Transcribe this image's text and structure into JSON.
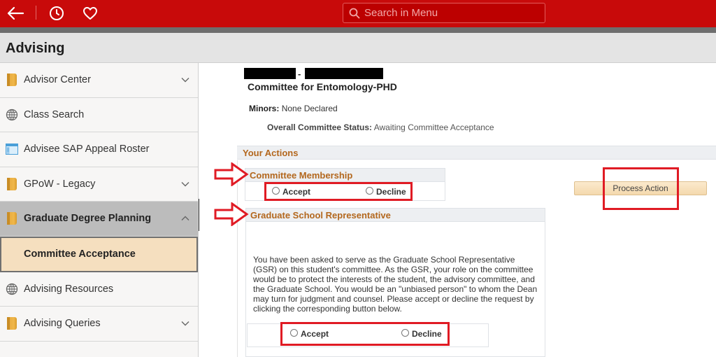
{
  "topbar": {
    "back_icon": "arrow-left-icon",
    "history_icon": "clock-icon",
    "favorites_icon": "heart-icon",
    "search_placeholder": "Search in Menu",
    "search_icon": "search-icon"
  },
  "page": {
    "title": "Advising"
  },
  "sidebar": {
    "items": [
      {
        "label": "Advisor Center",
        "icon": "folder-icon",
        "expandable": true,
        "expanded": false
      },
      {
        "label": "Class Search",
        "icon": "globe-icon",
        "expandable": false
      },
      {
        "label": "Advisee SAP Appeal Roster",
        "icon": "window-icon",
        "expandable": false
      },
      {
        "label": "GPoW - Legacy",
        "icon": "folder-icon",
        "expandable": true,
        "expanded": false
      },
      {
        "label": "Graduate Degree Planning",
        "icon": "folder-icon",
        "expandable": true,
        "expanded": true
      },
      {
        "label": "Committee Acceptance",
        "icon": "",
        "selected": true
      },
      {
        "label": "Advising Resources",
        "icon": "globe-icon",
        "expandable": false
      },
      {
        "label": "Advising Queries",
        "icon": "folder-icon",
        "expandable": true,
        "expanded": false
      }
    ]
  },
  "main": {
    "student_separator": "-",
    "committee_title": "Committee for Entomology-PHD",
    "minors_label": "Minors:",
    "minors_value": "None Declared",
    "status_label": "Overall Committee Status:",
    "status_value": "Awaiting Committee Acceptance",
    "your_actions_label": "Your Actions",
    "committee_membership": {
      "label": "Committee Membership",
      "options": [
        "Accept",
        "Decline"
      ]
    },
    "gsr": {
      "label": "Graduate School Representative",
      "description": "You have been asked to serve as the Graduate School Representative (GSR) on this student's committee. As the GSR, your role on the committee would be to protect the interests of the student, the advisory committee, and the Graduate School. You would be an \"unbiased person\" to whom the Dean may turn for judgment and counsel. Please accept or decline the request by clicking the corresponding button below.",
      "options": [
        "Accept",
        "Decline"
      ]
    },
    "process_button": "Process Action"
  },
  "annotation_colors": {
    "highlight": "#e01b24",
    "topbar": "#c80a0a",
    "section_heading": "#b3671d",
    "selected_item": "#f5dfbf"
  }
}
